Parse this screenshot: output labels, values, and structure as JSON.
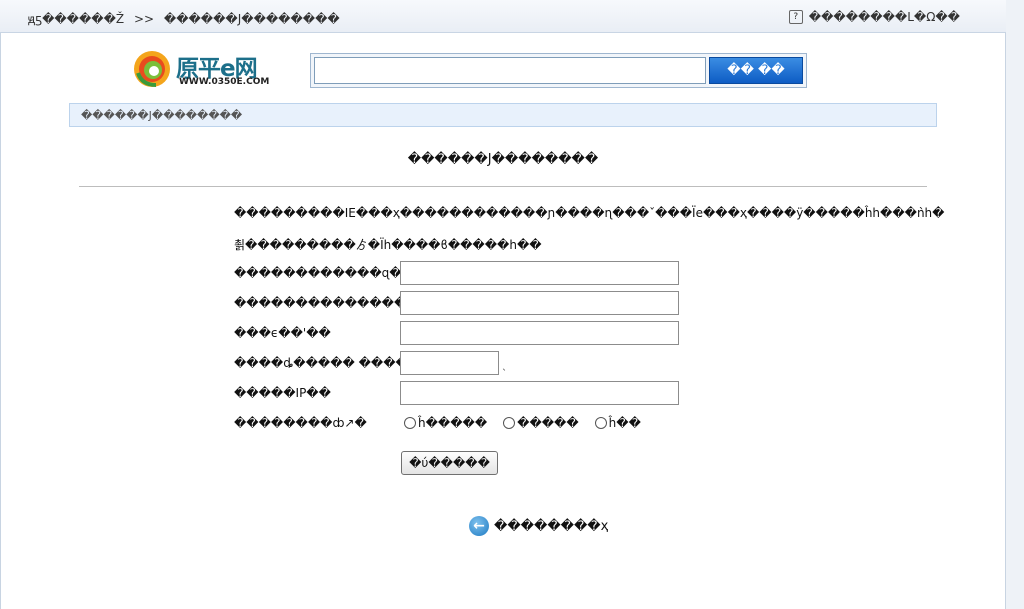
{
  "topbar": {
    "breadcrumb_home": "ԭƽ������Ž",
    "breadcrumb_sep": ">>",
    "breadcrumb_current": "������J��������",
    "help_icon": "help-icon",
    "help_label": "��������Ⅼ�Ω��"
  },
  "logo": {
    "name": "原平e网",
    "url": "WWW.0350E.COM"
  },
  "search": {
    "value": "",
    "button_label": "�� ��"
  },
  "location_bar": {
    "text": "������J��������"
  },
  "page": {
    "title": "������J��������",
    "intro_line1": "���������ΙE���ҳ������������ɲ����ɳ���ˇ���Ïe���ҳ����ÿ�����ĥh���ǹh�",
    "intro_line2": "쵥���������ゟ�Ïh����ϐ�����h��"
  },
  "form": {
    "fields": [
      {
        "label": "������������ɋ�",
        "value": ""
      },
      {
        "label": "���������������",
        "value": ""
      },
      {
        "label": "���ϵ��'��",
        "value": ""
      },
      {
        "label": "����ȡ���͏�� �����",
        "value": ""
      },
      {
        "label": "�����IP��",
        "value": ""
      }
    ],
    "captcha_suffix": "ˎ",
    "radio_label": "��������ȸ↗�",
    "radio_options": [
      "ĥ�����",
      "�����",
      "ĥ��"
    ],
    "submit_label": "�ύ�����"
  },
  "back": {
    "icon": "back-arrow-icon",
    "label": "��������ҳ"
  }
}
